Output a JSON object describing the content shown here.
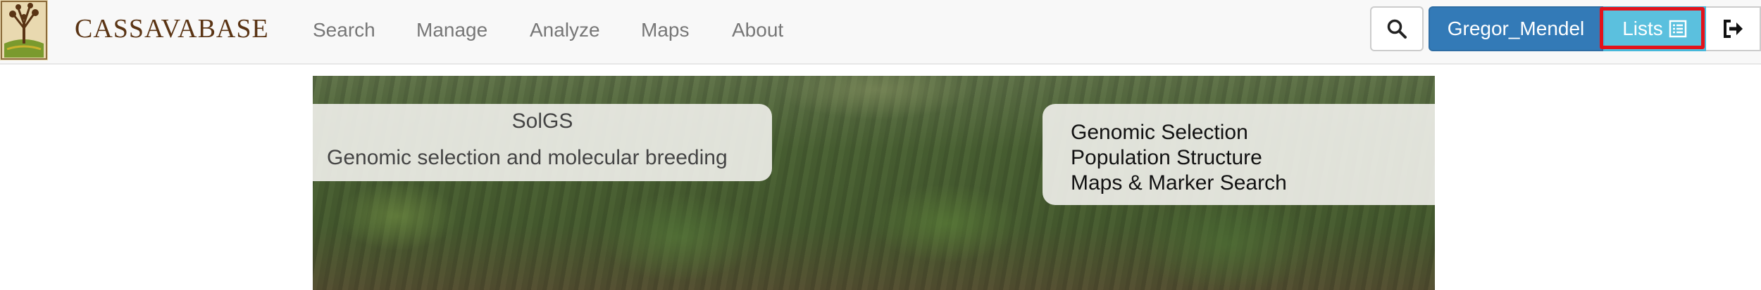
{
  "navbar": {
    "brand": "CASSAVABASE",
    "menu": [
      {
        "label": "Search"
      },
      {
        "label": "Manage"
      },
      {
        "label": "Analyze"
      },
      {
        "label": "Maps"
      },
      {
        "label": "About"
      }
    ],
    "user_label": "Gregor_Mendel",
    "lists_label": "Lists",
    "icons": {
      "search": "search-icon",
      "lists": "list-icon",
      "logout": "logout-icon",
      "logo": "cassava-tree-logo"
    }
  },
  "hero": {
    "title": "SolGS",
    "subtitle": "Genomic selection and molecular breeding",
    "features": [
      {
        "label": "Genomic Selection"
      },
      {
        "label": "Population Structure"
      },
      {
        "label": "Maps & Marker Search"
      }
    ]
  },
  "colors": {
    "brand": "#5a3414",
    "user_button": "#337ab7",
    "lists_button": "#5bc0de",
    "highlight": "#e3131b"
  }
}
